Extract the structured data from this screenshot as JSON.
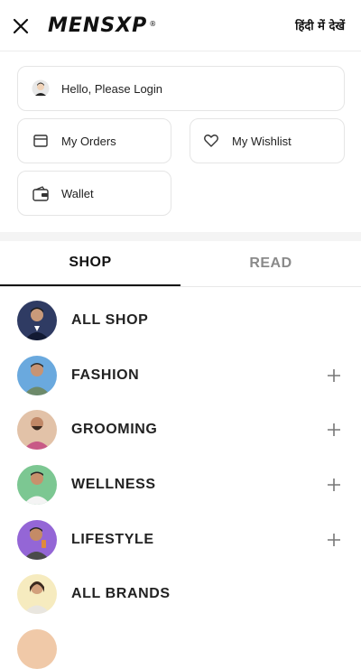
{
  "header": {
    "close_icon": "close-icon",
    "logo_text": "MENSXP",
    "logo_mark": "®",
    "language_link": "हिंदी में देखें"
  },
  "account": {
    "login_label": "Hello, Please Login",
    "orders_label": "My Orders",
    "wishlist_label": "My Wishlist",
    "wallet_label": "Wallet",
    "icons": [
      "user-avatar-icon",
      "orders-box-icon",
      "heart-icon",
      "wallet-icon"
    ]
  },
  "tabs": [
    {
      "label": "SHOP",
      "active": true
    },
    {
      "label": "READ",
      "active": false
    }
  ],
  "menu": [
    {
      "label": "ALL SHOP",
      "expandable": false,
      "avatar_bg": "#2a3a6a"
    },
    {
      "label": "FASHION",
      "expandable": true,
      "avatar_bg": "#5b9ad6"
    },
    {
      "label": "GROOMING",
      "expandable": true,
      "avatar_bg": "#d9b59a"
    },
    {
      "label": "WELLNESS",
      "expandable": true,
      "avatar_bg": "#6fbf86"
    },
    {
      "label": "LIFESTYLE",
      "expandable": true,
      "avatar_bg": "#8a5fd0"
    },
    {
      "label": "ALL BRANDS",
      "expandable": false,
      "avatar_bg": "#f3e7b8"
    }
  ],
  "colors": {
    "text": "#1a1a1a",
    "muted": "#8a8a8a",
    "border": "#e5e5e5",
    "band": "#f4f4f4"
  }
}
